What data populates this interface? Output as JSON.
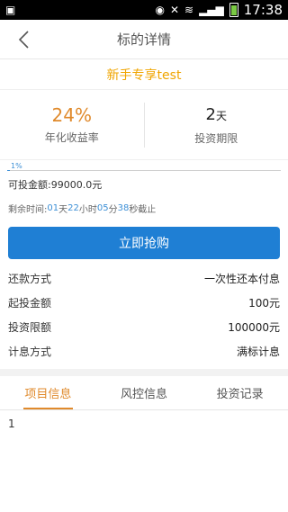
{
  "status_bar": {
    "time": "17:38",
    "icons": [
      "notification-icon",
      "eye-icon",
      "mute-icon",
      "wifi-icon",
      "signal-icon",
      "battery-icon"
    ]
  },
  "header": {
    "title": "标的详情",
    "back_icon": "chevron-left-icon"
  },
  "product": {
    "name": "新手专享test"
  },
  "stats": {
    "rate": "24%",
    "rate_label": "年化收益率",
    "term_value": "2",
    "term_unit": "天",
    "term_label": "投资期限"
  },
  "progress": {
    "percent": 1,
    "text": "1%"
  },
  "available": {
    "label": "可投金额:",
    "value": "99000.0元"
  },
  "remaining": {
    "label": "剩余时间:",
    "days": "01",
    "days_unit": "天",
    "hours": "22",
    "hours_unit": "小时",
    "minutes": "05",
    "minutes_unit": "分",
    "seconds": "38",
    "seconds_unit": "秒截止"
  },
  "buy_button": {
    "label": "立即抢购"
  },
  "details": [
    {
      "label": "还款方式",
      "value": "一次性还本付息"
    },
    {
      "label": "起投金额",
      "value": "100元"
    },
    {
      "label": "投资限额",
      "value": "100000元"
    },
    {
      "label": "计息方式",
      "value": "满标计息"
    }
  ],
  "tabs": [
    {
      "label": "项目信息",
      "active": true
    },
    {
      "label": "风控信息",
      "active": false
    },
    {
      "label": "投资记录",
      "active": false
    }
  ],
  "tab_content": {
    "text": "1"
  },
  "colors": {
    "accent_orange": "#e08a2c",
    "product_yellow": "#f0a500",
    "primary_blue": "#1f7fd4",
    "link_blue": "#3c8fd6"
  }
}
